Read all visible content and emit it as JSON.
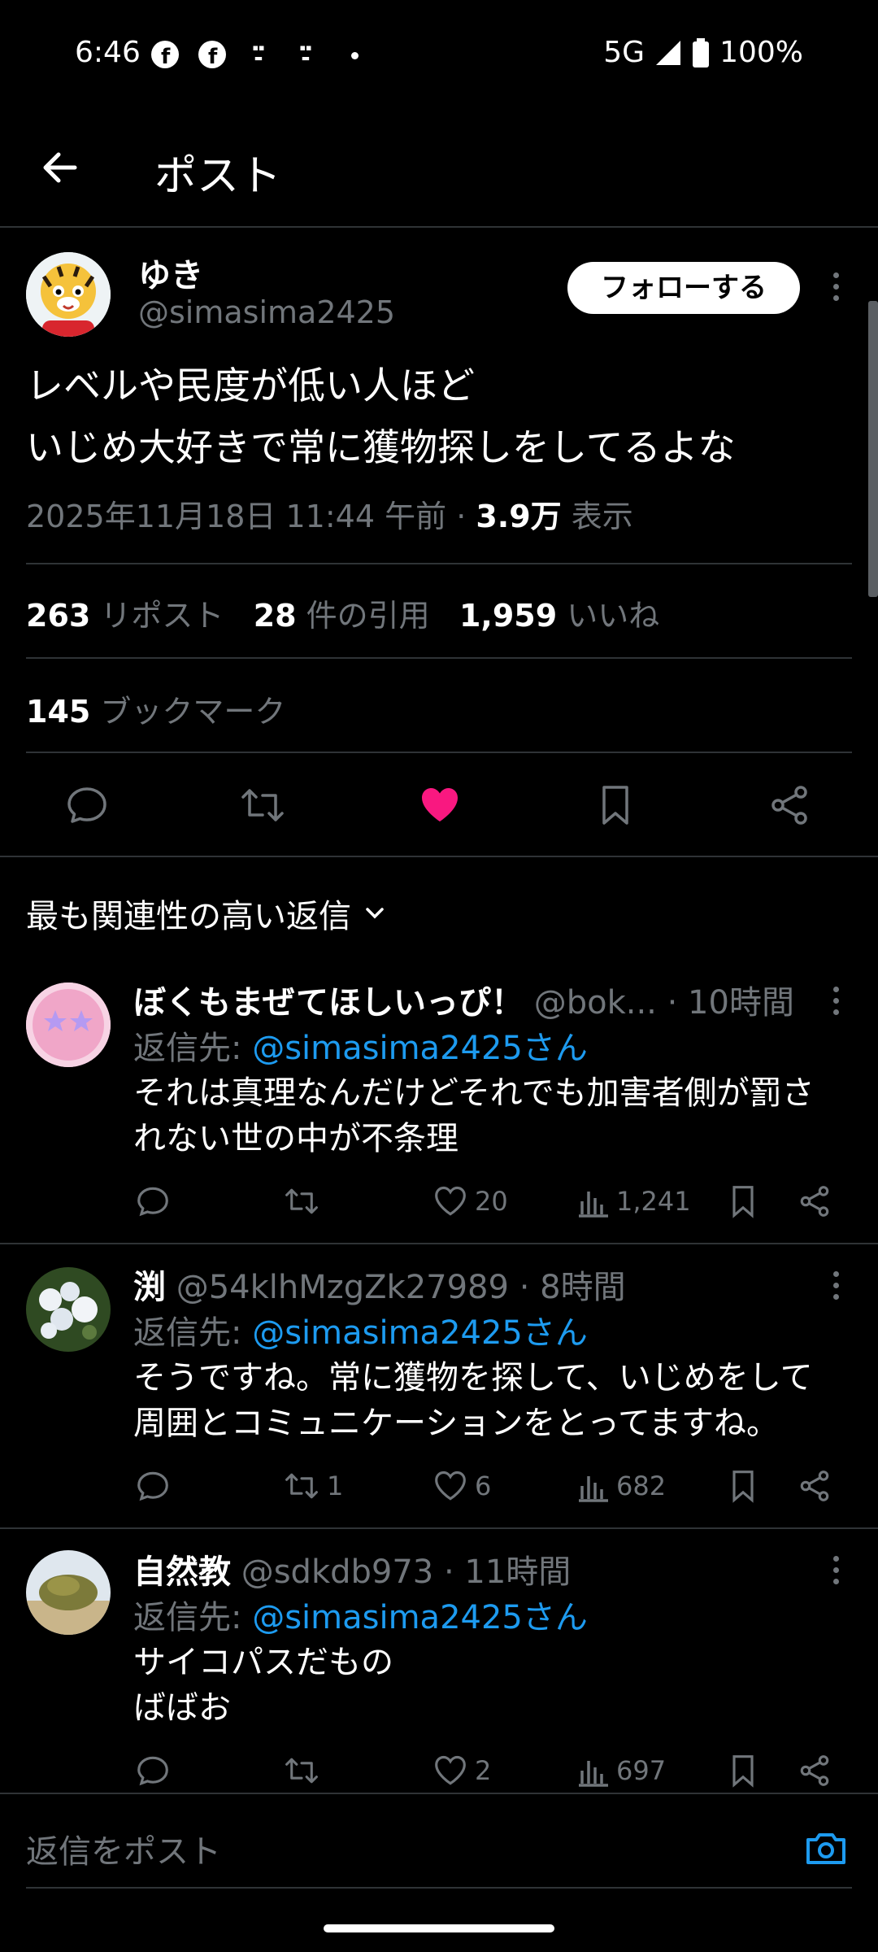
{
  "status_bar": {
    "time": "6:46",
    "network": "5G",
    "battery": "100%"
  },
  "header": {
    "title": "ポスト"
  },
  "tweet": {
    "author_name": "ゆき",
    "author_handle": "@simasima2425",
    "follow_label": "フォローする",
    "text_line1": "レベルや民度が低い人ほど",
    "text_line2": "いじめ大好きで常に獲物探しをしてるよな",
    "timestamp": "2025年11月18日 11:44 午前",
    "views_count": "3.9万",
    "views_label": "表示",
    "reposts_count": "263",
    "reposts_label": "リポスト",
    "quotes_count": "28",
    "quotes_label": "件の引用",
    "likes_count": "1,959",
    "likes_label": "いいね",
    "bookmarks_count": "145",
    "bookmarks_label": "ブックマーク"
  },
  "replies_sort": {
    "label": "最も関連性の高い返信"
  },
  "replies": [
    {
      "name": "ぼくもまぜてほしいっぴ！",
      "handle": "@bok...",
      "time": "10時間",
      "reply_prefix": "返信先:",
      "reply_to": "@simasima2425さん",
      "line1": "それは真理なんだけどそれでも加害者側が罰さ",
      "line2": "れない世の中が不条理",
      "reposts": "",
      "likes": "20",
      "views": "1,241"
    },
    {
      "name": "渕",
      "handle": "@54klhMzgZk27989",
      "time": "8時間",
      "reply_prefix": "返信先:",
      "reply_to": "@simasima2425さん",
      "line1": "そうですね。常に獲物を探して、いじめをして",
      "line2": "周囲とコミュニケーションをとってますね。",
      "reposts": "1",
      "likes": "6",
      "views": "682"
    },
    {
      "name": "自然教",
      "handle": "@sdkdb973",
      "time": "11時間",
      "reply_prefix": "返信先:",
      "reply_to": "@simasima2425さん",
      "line1": "サイコパスだもの",
      "line2": "ばばお",
      "reposts": "",
      "likes": "2",
      "views": "697"
    }
  ],
  "compose": {
    "placeholder": "返信をポスト"
  },
  "colors": {
    "background": "#000000",
    "link": "#1d9bf0",
    "like_active": "#f91880",
    "muted": "#71767b"
  }
}
